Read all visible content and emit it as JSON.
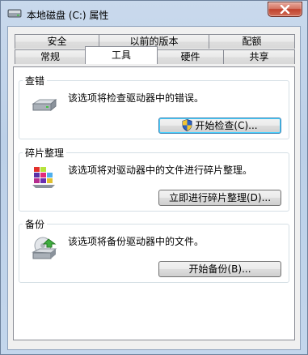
{
  "window": {
    "title": "本地磁盘 (C:) 属性"
  },
  "tabs_top_row": [
    {
      "label": "安全"
    },
    {
      "label": "以前的版本"
    },
    {
      "label": "配额"
    }
  ],
  "tabs_bottom_row": [
    {
      "label": "常规"
    },
    {
      "label": "工具",
      "active": true
    },
    {
      "label": "硬件"
    },
    {
      "label": "共享"
    }
  ],
  "groups": {
    "error_check": {
      "title": "查错",
      "description": "该选项将检查驱动器中的错误。",
      "button_label": "开始检查(C)..."
    },
    "defrag": {
      "title": "碎片整理",
      "description": "该选项将对驱动器中的文件进行碎片整理。",
      "button_label": "立即进行碎片整理(D)..."
    },
    "backup": {
      "title": "备份",
      "description": "该选项将备份驱动器中的文件。",
      "button_label": "开始备份(B)..."
    }
  },
  "icons": {
    "title": "drive-icon",
    "close": "close-icon",
    "error_check": "hard-drive-icon",
    "defrag": "defrag-icon",
    "backup": "backup-icon",
    "uac": "uac-shield-icon"
  },
  "colors": {
    "accent": "#3c7fb1",
    "close": "#c0422e"
  }
}
